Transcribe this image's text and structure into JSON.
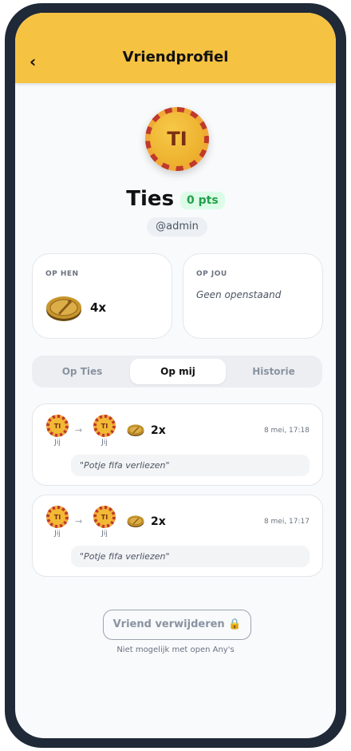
{
  "header": {
    "back_icon": "chevron-left-icon",
    "back_glyph": "‹",
    "title": "Vriendprofiel"
  },
  "profile": {
    "initials": "TI",
    "name": "Ties",
    "points": "0 pts",
    "handle": "@admin"
  },
  "summary": {
    "op_hen": {
      "label": "OP HEN",
      "icon": "coin-icon",
      "count": "4x"
    },
    "op_jou": {
      "label": "OP JOU",
      "empty_text": "Geen openstaand"
    }
  },
  "tabs": [
    {
      "label": "Op Ties",
      "active": false
    },
    {
      "label": "Op mij",
      "active": true
    },
    {
      "label": "Historie",
      "active": false
    }
  ],
  "bets": [
    {
      "from_initials": "TI",
      "from_label": "Jij",
      "arrow": "→",
      "to_initials": "TI",
      "to_label": "Jij",
      "count": "2x",
      "time": "8 mei, 17:18",
      "description": "\"Potje fifa verliezen\""
    },
    {
      "from_initials": "TI",
      "from_label": "Jij",
      "arrow": "→",
      "to_initials": "TI",
      "to_label": "Jij",
      "count": "2x",
      "time": "8 mei, 17:17",
      "description": "\"Potje fifa verliezen\""
    }
  ],
  "actions": {
    "remove_label": "Vriend verwijderen 🔒",
    "remove_note": "Niet mogelijk met open Any's"
  },
  "colors": {
    "accent": "#f5c242",
    "points_green": "#22a04a",
    "chip_red": "#c0392b",
    "chip_gold": "#f0a836"
  }
}
